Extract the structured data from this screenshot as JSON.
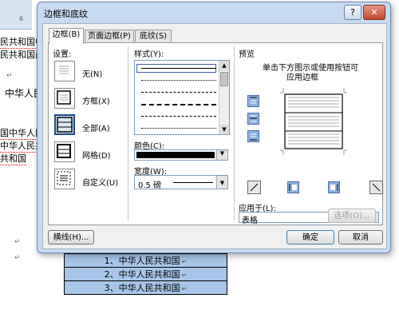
{
  "document": {
    "ruler_number": "6",
    "lines": [
      {
        "text": "民共和国中",
        "underline": true
      },
      {
        "text": "民共和国西",
        "underline": false
      },
      {
        "text": "中华人民",
        "underline": false
      },
      {
        "text": "国中华人民",
        "underline": true
      },
      {
        "text": "中华人民共",
        "underline": true
      },
      {
        "text": "共和国",
        "underline": true
      }
    ],
    "pilcrow": "↵",
    "table_rows": [
      "1、中华人民共和国",
      "2、中华人民共和国",
      "3、中华人民共和国"
    ]
  },
  "dialog": {
    "title": "边框和底纹",
    "help_button": "?",
    "close_button": "✕",
    "tabs": [
      {
        "label": "边框(B)",
        "active": true
      },
      {
        "label": "页面边框(P)",
        "active": false
      },
      {
        "label": "底纹(S)",
        "active": false
      }
    ],
    "settings": {
      "heading": "设置:",
      "items": [
        {
          "label": "无(N)",
          "selected": false
        },
        {
          "label": "方框(X)",
          "selected": false
        },
        {
          "label": "全部(A)",
          "selected": true
        },
        {
          "label": "网格(D)",
          "selected": false
        },
        {
          "label": "自定义(U)",
          "selected": false
        }
      ]
    },
    "style": {
      "heading": "样式(Y):",
      "scroll_up": "▲",
      "scroll_down": "▼"
    },
    "color": {
      "label": "颜色(C):",
      "value": "#000000"
    },
    "width": {
      "label": "宽度(W):",
      "value": "0.5 磅"
    },
    "preview": {
      "heading": "预览",
      "instruction_line1": "单击下方图示或使用按钮可",
      "instruction_line2": "应用边框"
    },
    "apply_to": {
      "label": "应用于(L):",
      "value": "表格"
    },
    "options_button": "选项(O)...",
    "horizontal_line_button": "横线(H)...",
    "ok_button": "确定",
    "cancel_button": "取消",
    "dropdown_arrow": "▼"
  }
}
